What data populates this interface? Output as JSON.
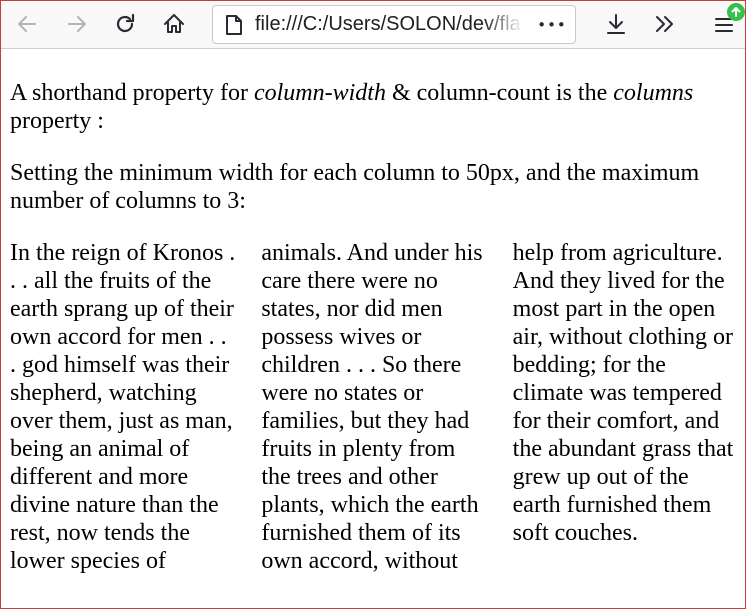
{
  "browser": {
    "url_main": "file:///C:/Users/SOLON/dev/fla",
    "page_actions_label": "•••",
    "icons": {
      "back": "arrow-left-icon",
      "forward": "arrow-right-icon",
      "reload": "reload-icon",
      "home": "home-icon",
      "page": "page-icon",
      "download": "download-icon",
      "overflow": "double-chevron-icon",
      "menu": "hamburger-menu-icon",
      "update": "update-arrow-icon"
    },
    "colors": {
      "update_badge": "#34c14b",
      "window_border": "#cf3b3b"
    }
  },
  "content": {
    "para1": {
      "t1": "A shorthand property for ",
      "em1": "column-width",
      "t2": " & column-count is the ",
      "em2": "columns",
      "t3": " property :"
    },
    "para2": "Setting the minimum width for each column to 50px, and the maximum number of columns to 3:",
    "columns_text": "In the reign of Kronos . . . all the fruits of the earth sprang up of their own accord for men . . . god himself was their shepherd, watching over them, just as man, being an animal of different and more divine nature than the rest, now tends the lower species of animals. And under his care there were no states, nor did men possess wives or children . . . So there were no states or families, but they had fruits in plenty from the trees and other plants, which the earth furnished them of its own accord, without help from agriculture. And they lived for the most part in the open air, without clothing or bedding; for the climate was tempered for their comfort, and the abundant grass that grew up out of the earth furnished them soft couches."
  }
}
